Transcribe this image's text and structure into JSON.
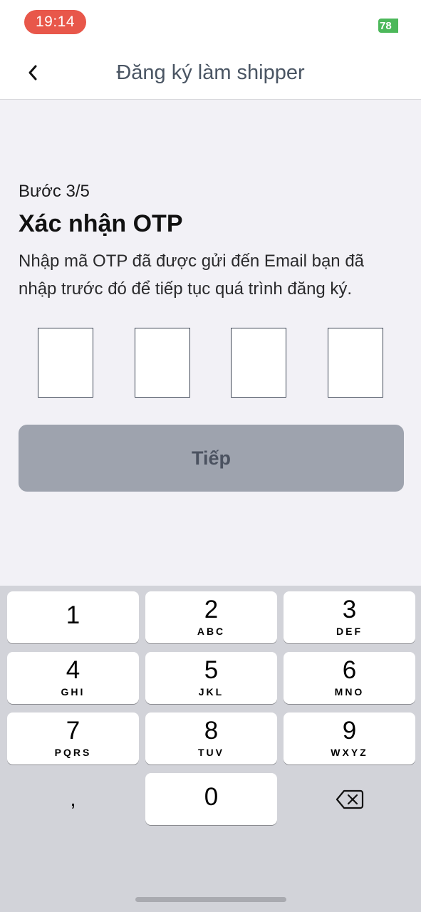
{
  "status_bar": {
    "time": "19:14",
    "battery": "78"
  },
  "nav": {
    "title": "Đăng ký làm shipper",
    "back_icon": "chevron-left-icon"
  },
  "content": {
    "step": "Bước 3/5",
    "heading": "Xác nhận OTP",
    "description": "Nhập mã OTP đã được gửi đến Email bạn đã nhập trước đó để tiếp tục quá trình đăng ký.",
    "otp_digits": [
      "",
      "",
      "",
      ""
    ],
    "next_button": "Tiếp"
  },
  "keypad": {
    "keys": [
      {
        "digit": "1",
        "letters": ""
      },
      {
        "digit": "2",
        "letters": "ABC"
      },
      {
        "digit": "3",
        "letters": "DEF"
      },
      {
        "digit": "4",
        "letters": "GHI"
      },
      {
        "digit": "5",
        "letters": "JKL"
      },
      {
        "digit": "6",
        "letters": "MNO"
      },
      {
        "digit": "7",
        "letters": "PQRS"
      },
      {
        "digit": "8",
        "letters": "TUV"
      },
      {
        "digit": "9",
        "letters": "WXYZ"
      },
      {
        "digit": "0",
        "letters": ""
      }
    ],
    "comma": ",",
    "delete_icon": "backspace-icon"
  },
  "colors": {
    "time_pill": "#e8574a",
    "battery": "#4cb85a",
    "button_disabled": "#9ea3ae",
    "button_text": "#4b5260",
    "keypad_bg": "#d2d3d9"
  }
}
